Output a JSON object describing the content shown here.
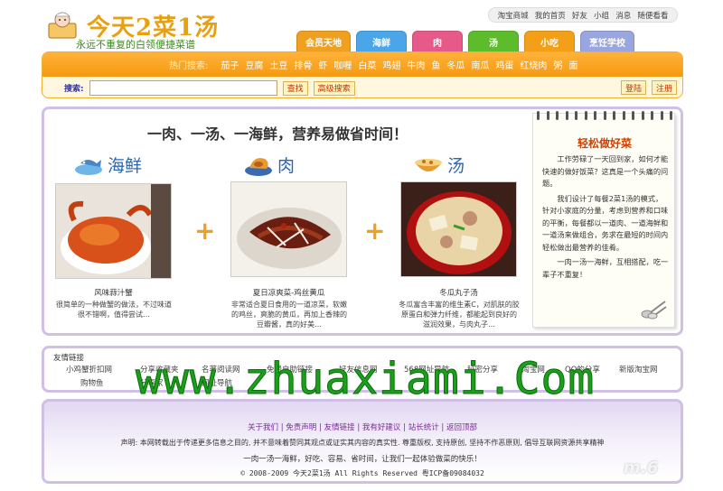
{
  "header": {
    "logo_title": "今天2菜1汤",
    "logo_slogan": "永远不重复的白领便捷菜谱",
    "top_links": [
      "淘宝商城",
      "我的首页",
      "好友",
      "小组",
      "消息",
      "随便看看"
    ]
  },
  "tabs": [
    {
      "label": "会员天地",
      "color": "#f0a020"
    },
    {
      "label": "海鲜",
      "color": "#4aa6e8"
    },
    {
      "label": "肉",
      "color": "#e65a8a"
    },
    {
      "label": "汤",
      "color": "#5cbc2c"
    },
    {
      "label": "小吃",
      "color": "#f3a018"
    },
    {
      "label": "烹饪学校",
      "color": "#9aa6e0"
    }
  ],
  "search": {
    "hot_label": "热门搜索:",
    "hot_keywords": [
      "茄子",
      "豆腐",
      "土豆",
      "排骨",
      "虾",
      "咖喱",
      "白菜",
      "鸡翅",
      "牛肉",
      "鱼",
      "冬瓜",
      "南瓜",
      "鸡蛋",
      "红烧肉",
      "粥",
      "面"
    ],
    "label": "搜索:",
    "input_value": "",
    "search_button": "查找",
    "advanced_button": "高级搜索",
    "login_button": "登陆",
    "register_button": "注册"
  },
  "main": {
    "headline": "一肉、一汤、一海鲜，营养易做省时间！",
    "categories": [
      {
        "title": "海鲜",
        "dish_name": "风味蒜汁蟹",
        "dish_desc": "很简单的一种做蟹的做法，不过味道很不错啊，值得尝试…"
      },
      {
        "title": "肉",
        "dish_name": "夏日凉爽菜-鸡丝黄瓜",
        "dish_desc": "非常适合夏日食用的一道凉菜，软嫩的鸡丝，爽脆的黄瓜，再加上香辣的豆瓣酱，真的好美…"
      },
      {
        "title": "汤",
        "dish_name": "冬瓜丸子汤",
        "dish_desc": "冬瓜富含丰富的维生素C，对肌肤的胶原蛋白和弹力纤维，都能起到良好的滋润效果，与肉丸子…"
      }
    ],
    "plus_sign": "+",
    "notepad": {
      "title": "轻松做好菜",
      "paragraphs": [
        "工作劳碌了一天回到家，如何才能快速的做好饭菜？这真是一个头痛的问题。",
        "我们设计了每餐2菜1汤的模式，针对小家庭的分量，考虑到营养和口味的平衡，每餐都以一道肉、一道海鲜和一道汤来做组合，务求在最短的时间内轻松做出最营养的佳肴。",
        "一肉一汤一海鲜，互相搭配，吃一辈子不重复！"
      ]
    }
  },
  "links": {
    "title": "友情链接",
    "row1": [
      "小鸡蟹折扣网",
      "分享收藏夹",
      "名著阅读网",
      "免费自助链接",
      "好友信息网",
      "568网址导航",
      "秘密分享",
      "i淘宝网",
      "QQ的分享",
      "新版淘宝网"
    ],
    "row2": [
      "购物鱼",
      "分享家",
      "网址导航"
    ]
  },
  "footer": {
    "nav": [
      "关于我们",
      "免责声明",
      "友情链接",
      "我有好建议",
      "站长统计",
      "返回顶部"
    ],
    "separator": "|",
    "statement": "声明: 本网转载出于传递更多信息之目的, 并不意味着赞同其观点或证实其内容的真实性. 尊重版权, 支持原创, 坚持不作恶原则, 倡导互联网资源共享精神",
    "slogan": "一肉一汤一海鲜，好吃、容易、省时间，让我们一起体验做菜的快乐！",
    "copyright": "© 2008-2009 今天2菜1汤 All Rights Reserved  粤ICP备09084032"
  },
  "watermark": "www.zhuaxiami.Com",
  "corner_mark": "m.6"
}
